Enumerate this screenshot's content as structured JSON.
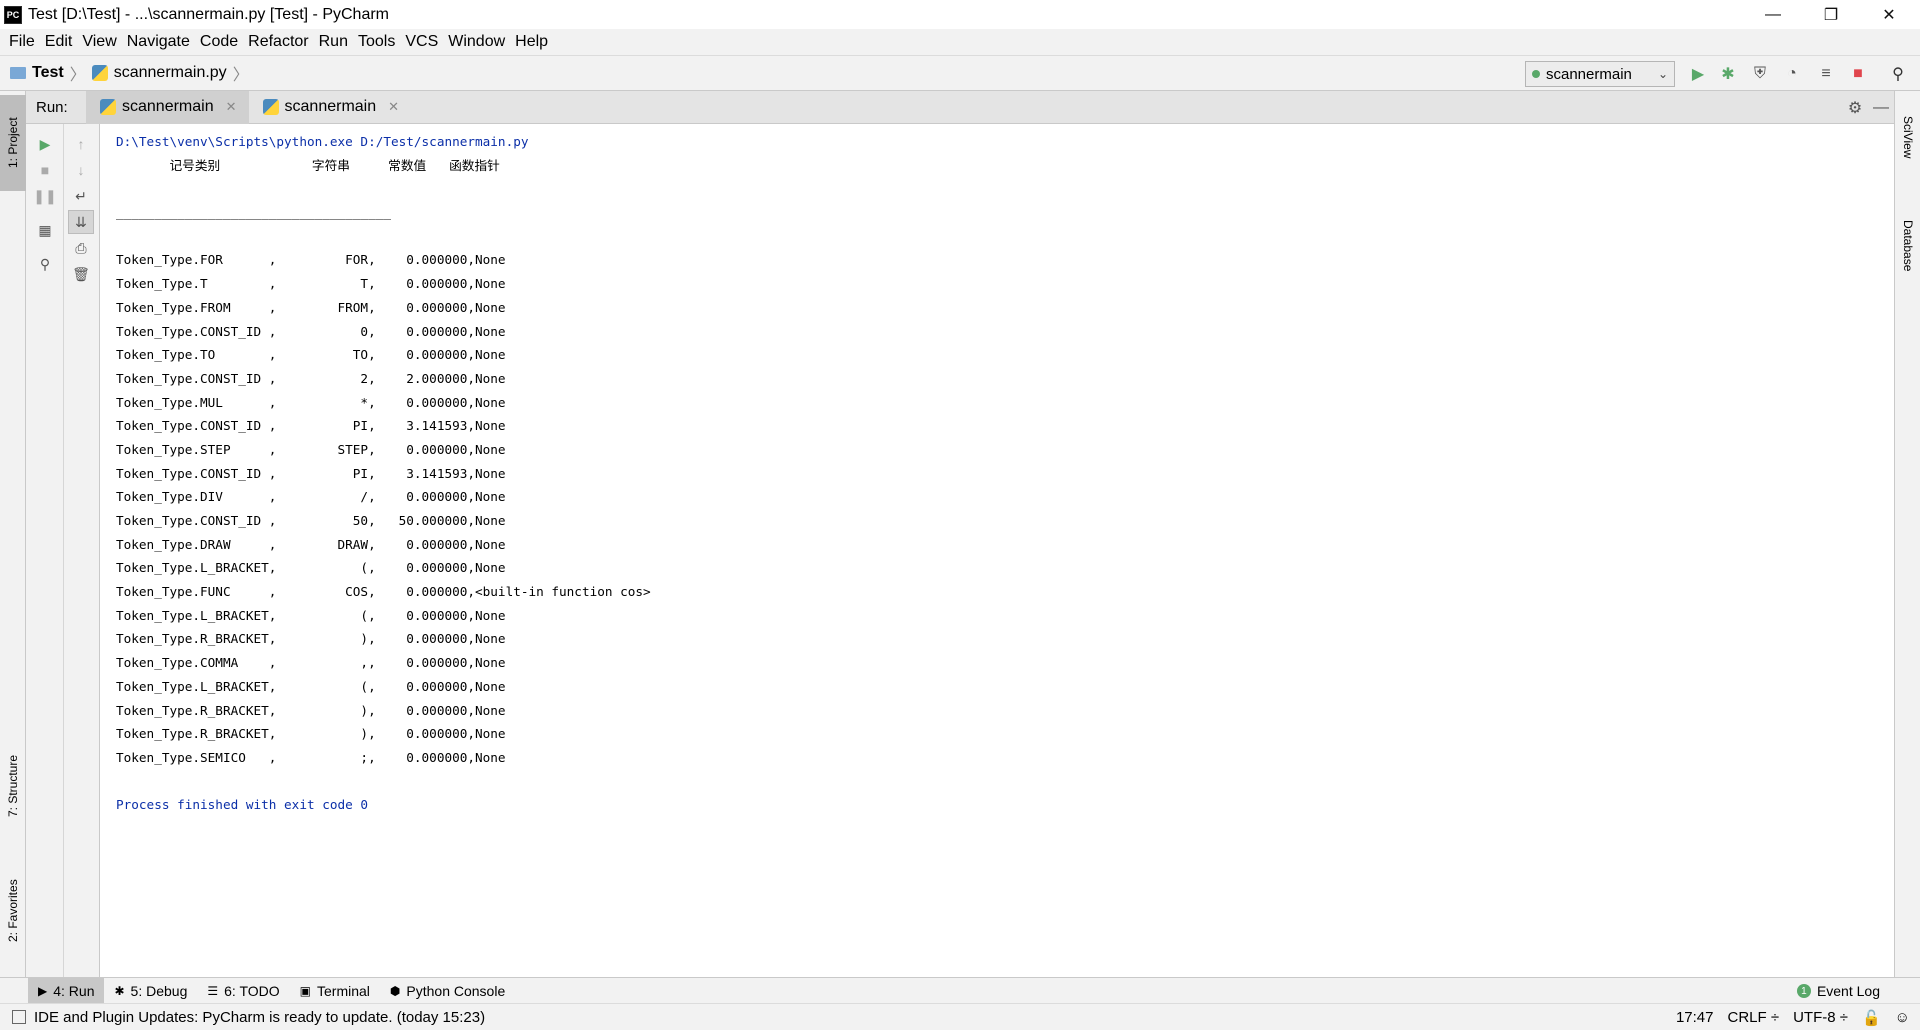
{
  "window": {
    "title": "Test [D:\\Test] - ...\\scannermain.py [Test] - PyCharm",
    "app_icon": "PC",
    "controls": [
      "—",
      "❐",
      "✕"
    ]
  },
  "menu": [
    "File",
    "Edit",
    "View",
    "Navigate",
    "Code",
    "Refactor",
    "Run",
    "Tools",
    "VCS",
    "Window",
    "Help"
  ],
  "breadcrumb": {
    "project": "Test",
    "file": "scannermain.py"
  },
  "run_config": {
    "label": "scannermain"
  },
  "left_strip": {
    "project": "1: Project",
    "structure": "7: Structure",
    "favorites": "2: Favorites"
  },
  "right_strip": {
    "sciview": "SciView",
    "database": "Database"
  },
  "run_panel": {
    "label": "Run:",
    "tabs": [
      "scannermain",
      "scannermain"
    ]
  },
  "console": {
    "command": "D:\\Test\\venv\\Scripts\\python.exe D:/Test/scannermain.py",
    "header": "       记号类别            字符串     常数值   函数指针",
    "separator": "____________________________________",
    "lines": [
      "Token_Type.FOR      ,         FOR,    0.000000,None",
      "Token_Type.T        ,           T,    0.000000,None",
      "Token_Type.FROM     ,        FROM,    0.000000,None",
      "Token_Type.CONST_ID ,           0,    0.000000,None",
      "Token_Type.TO       ,          TO,    0.000000,None",
      "Token_Type.CONST_ID ,           2,    2.000000,None",
      "Token_Type.MUL      ,           *,    0.000000,None",
      "Token_Type.CONST_ID ,          PI,    3.141593,None",
      "Token_Type.STEP     ,        STEP,    0.000000,None",
      "Token_Type.CONST_ID ,          PI,    3.141593,None",
      "Token_Type.DIV      ,           /,    0.000000,None",
      "Token_Type.CONST_ID ,          50,   50.000000,None",
      "Token_Type.DRAW     ,        DRAW,    0.000000,None",
      "Token_Type.L_BRACKET,           (,    0.000000,None",
      "Token_Type.FUNC     ,         COS,    0.000000,<built-in function cos>",
      "Token_Type.L_BRACKET,           (,    0.000000,None",
      "Token_Type.R_BRACKET,           ),    0.000000,None",
      "Token_Type.COMMA    ,           ,,    0.000000,None",
      "Token_Type.L_BRACKET,           (,    0.000000,None",
      "Token_Type.R_BRACKET,           ),    0.000000,None",
      "Token_Type.R_BRACKET,           ),    0.000000,None",
      "Token_Type.SEMICO   ,           ;,    0.000000,None"
    ],
    "exit": "Process finished with exit code 0"
  },
  "bottom_tabs": [
    {
      "label": "4: Run"
    },
    {
      "label": "5: Debug"
    },
    {
      "label": "6: TODO"
    },
    {
      "label": "Terminal"
    },
    {
      "label": "Python Console"
    }
  ],
  "event_log": "Event Log",
  "event_count": "1",
  "status": {
    "message": "IDE and Plugin Updates: PyCharm is ready to update. (today 15:23)",
    "position": "17:47",
    "line_sep": "CRLF ÷",
    "encoding": "UTF-8 ÷"
  },
  "colors": {
    "accent_green": "#59a869",
    "stop_red": "#e0454d",
    "console_blue": "#0b2fa8"
  }
}
